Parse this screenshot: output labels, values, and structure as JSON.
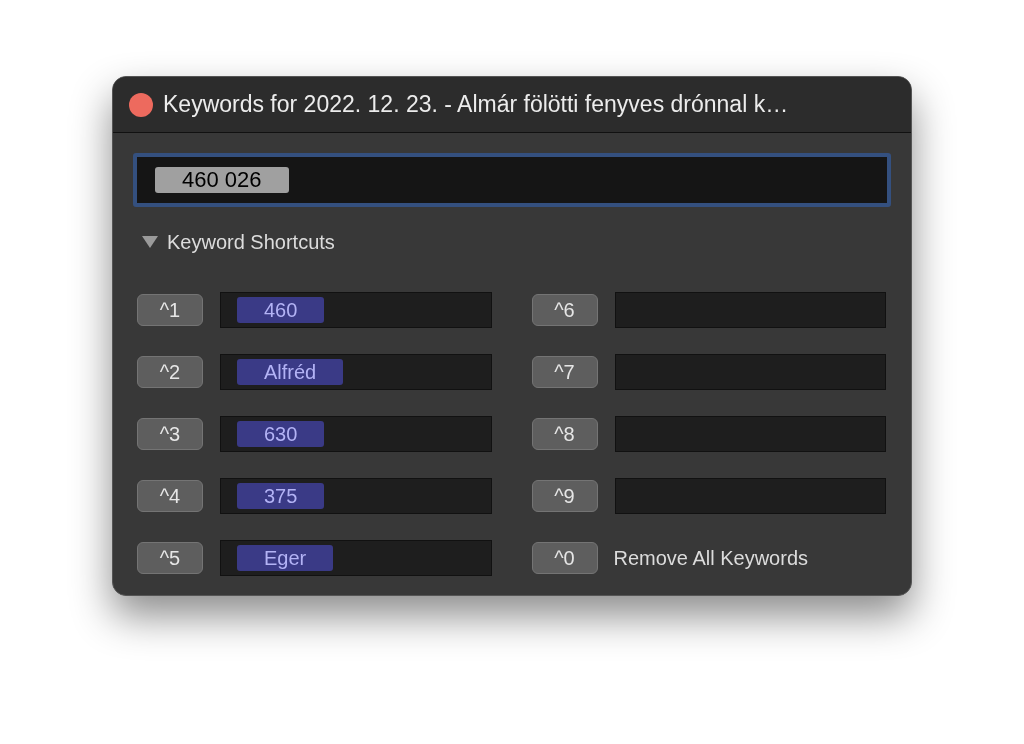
{
  "window": {
    "title": "Keywords for 2022. 12. 23. - Almár fölötti fenyves drónnal k…"
  },
  "keyword_field": {
    "tokens": [
      "460 026"
    ]
  },
  "section": {
    "label": "Keyword Shortcuts",
    "expanded": true
  },
  "shortcuts": [
    {
      "kind": "field",
      "key": "^1",
      "keyword": "460"
    },
    {
      "kind": "field",
      "key": "^2",
      "keyword": "Alfréd"
    },
    {
      "kind": "field",
      "key": "^3",
      "keyword": "630"
    },
    {
      "kind": "field",
      "key": "^4",
      "keyword": "375"
    },
    {
      "kind": "field",
      "key": "^5",
      "keyword": "Eger"
    },
    {
      "kind": "field",
      "key": "^6"
    },
    {
      "kind": "field",
      "key": "^7"
    },
    {
      "kind": "field",
      "key": "^8"
    },
    {
      "kind": "field",
      "key": "^9"
    },
    {
      "kind": "action",
      "key": "^0",
      "label": "Remove All Keywords"
    }
  ]
}
